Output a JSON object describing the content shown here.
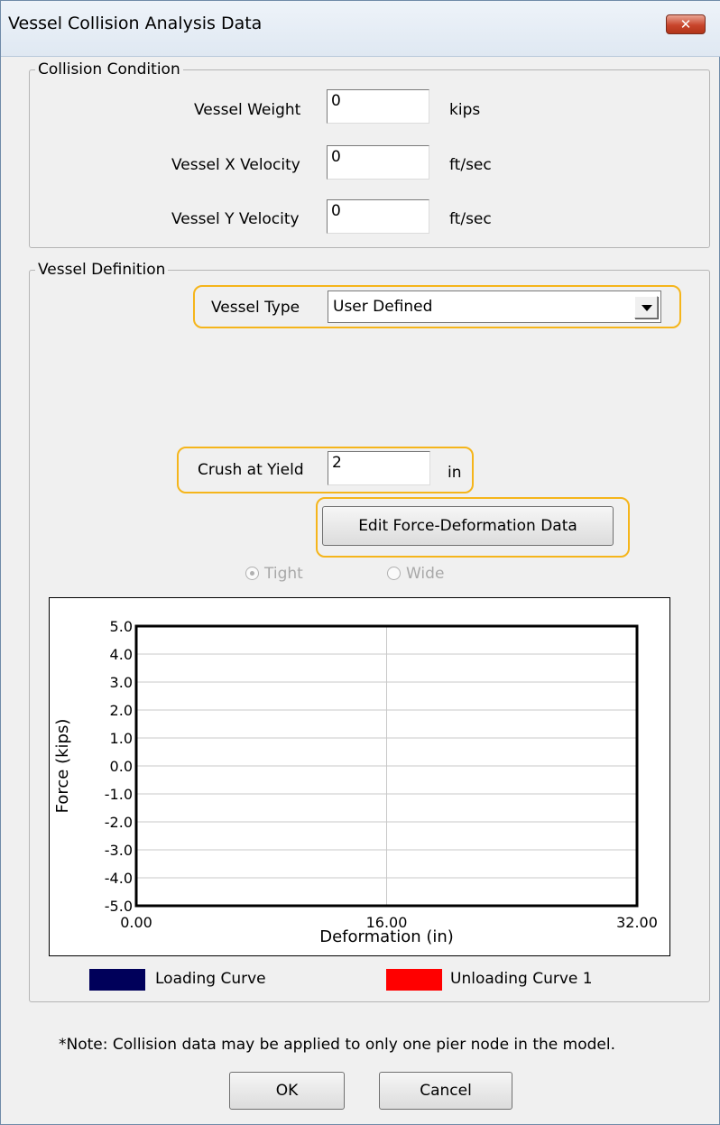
{
  "window": {
    "title": "Vessel Collision Analysis Data"
  },
  "collision_condition": {
    "legend": "Collision Condition",
    "weight": {
      "label": "Vessel Weight",
      "value": "0",
      "unit": "kips"
    },
    "x_velocity": {
      "label": "Vessel X Velocity",
      "value": "0",
      "unit": "ft/sec"
    },
    "y_velocity": {
      "label": "Vessel Y Velocity",
      "value": "0",
      "unit": "ft/sec"
    }
  },
  "vessel_definition": {
    "legend": "Vessel Definition",
    "vessel_type": {
      "label": "Vessel Type",
      "value": "User Defined"
    },
    "crush_at_yield": {
      "label": "Crush at Yield",
      "value": "2",
      "unit": "in"
    },
    "edit_button": "Edit Force-Deformation Data",
    "radio_tight": "Tight",
    "radio_wide": "Wide"
  },
  "highlight_color": "#f5b51b",
  "chart_data": {
    "type": "line",
    "title": "",
    "xlabel": "Deformation (in)",
    "ylabel": "Force (kips)",
    "xlim": [
      0,
      32
    ],
    "ylim": [
      -5,
      5
    ],
    "x_ticks": [
      "0.00",
      "16.00",
      "32.00"
    ],
    "y_ticks": [
      "5.0",
      "4.0",
      "3.0",
      "2.0",
      "1.0",
      "0.0",
      "-1.0",
      "-2.0",
      "-3.0",
      "-4.0",
      "-5.0"
    ],
    "series": [
      {
        "name": "Loading Curve",
        "color": "#00005a",
        "x": [],
        "y": []
      },
      {
        "name": "Unloading Curve 1",
        "color": "#ff0000",
        "x": [],
        "y": []
      }
    ],
    "grid": true
  },
  "note": "*Note: Collision data may be applied to only one pier node in the model.",
  "buttons": {
    "ok": "OK",
    "cancel": "Cancel"
  }
}
